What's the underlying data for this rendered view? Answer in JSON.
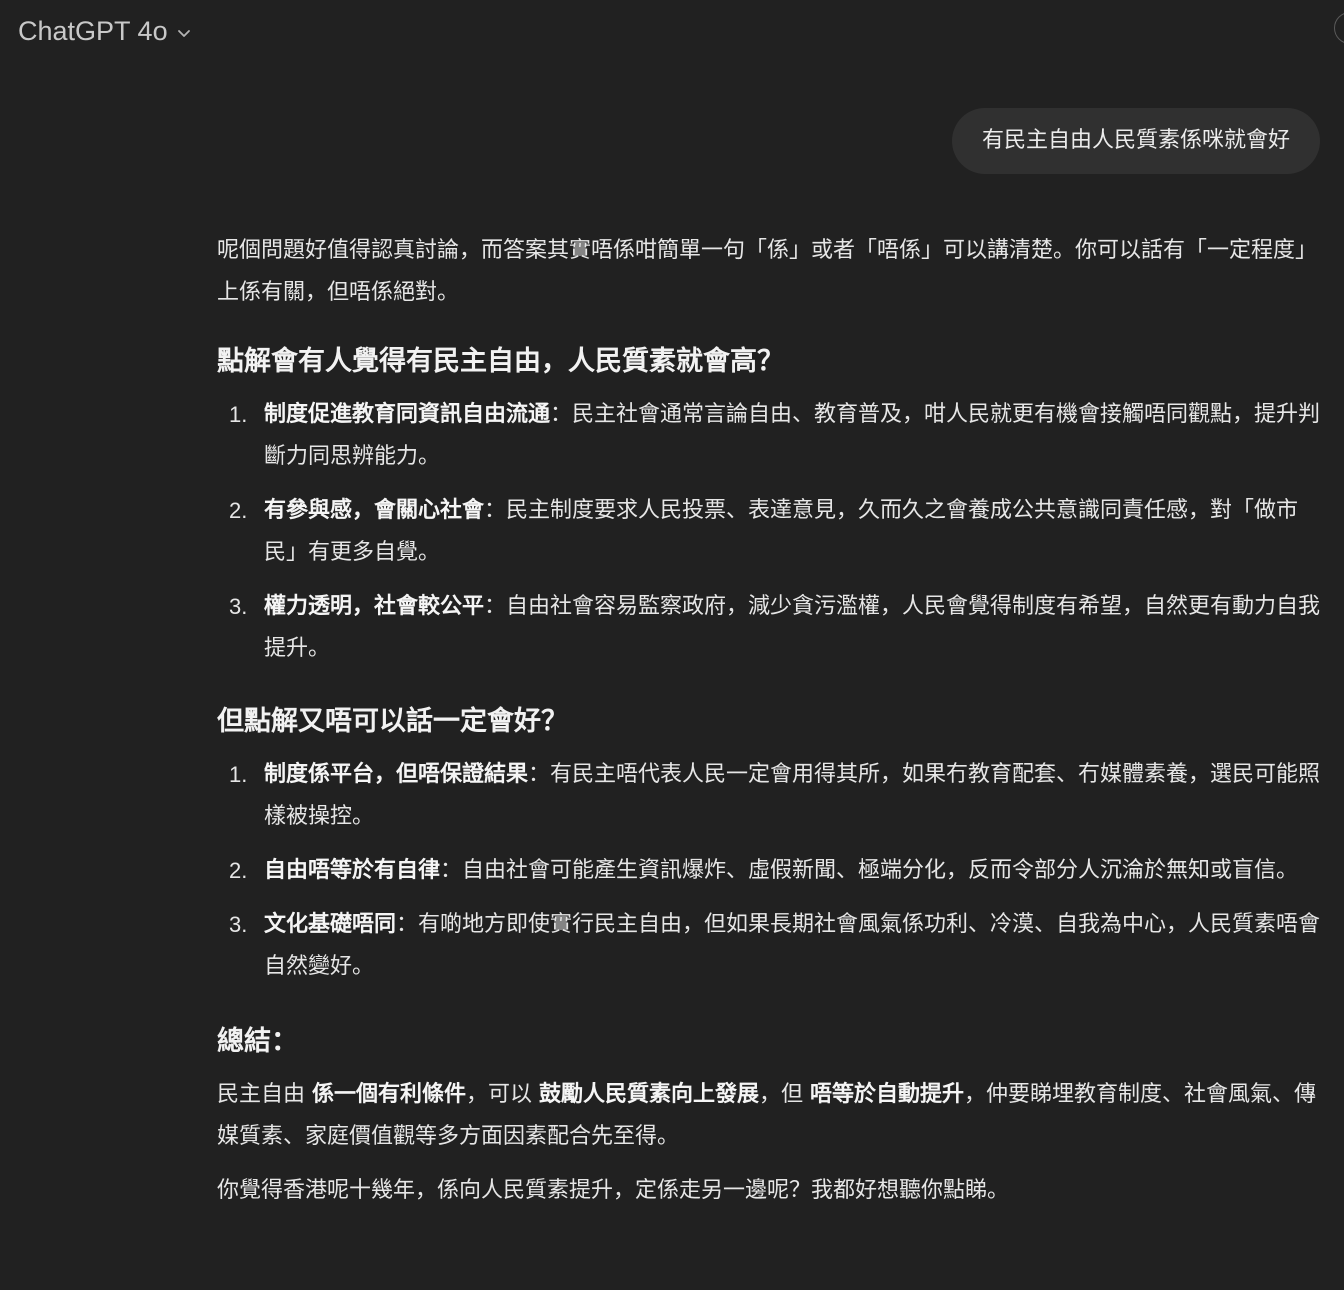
{
  "header": {
    "model_name": "ChatGPT 4o",
    "dropdown_icon": "chevron-down-icon"
  },
  "conversation": {
    "user_message": "有民主自由人民質素係咪就會好",
    "assistant": {
      "intro": "呢個問題好值得認真討論，而答案其實唔係咁簡單一句「係」或者「唔係」可以講清楚。你可以話有「一定程度」上係有關，但唔係絕對。",
      "section1": {
        "heading": "點解會有人覺得有民主自由，人民質素就會高？",
        "items": [
          {
            "num": "1.",
            "bold": "制度促進教育同資訊自由流通",
            "text": "：民主社會通常言論自由、教育普及，咁人民就更有機會接觸唔同觀點，提升判斷力同思辨能力。"
          },
          {
            "num": "2.",
            "bold": "有參與感，會關心社會",
            "text": "：民主制度要求人民投票、表達意見，久而久之會養成公共意識同責任感，對「做市民」有更多自覺。"
          },
          {
            "num": "3.",
            "bold": "權力透明，社會較公平",
            "text": "：自由社會容易監察政府，減少貪污濫權，人民會覺得制度有希望，自然更有動力自我提升。"
          }
        ]
      },
      "section2": {
        "heading": "但點解又唔可以話一定會好？",
        "items": [
          {
            "num": "1.",
            "bold": "制度係平台，但唔保證結果",
            "text": "：有民主唔代表人民一定會用得其所，如果冇教育配套、冇媒體素養，選民可能照樣被操控。"
          },
          {
            "num": "2.",
            "bold": "自由唔等於有自律",
            "text": "：自由社會可能產生資訊爆炸、虛假新聞、極端分化，反而令部分人沉淪於無知或盲信。"
          },
          {
            "num": "3.",
            "bold": "文化基礎唔同",
            "text": "：有啲地方即使實行民主自由，但如果長期社會風氣係功利、冷漠、自我為中心，人民質素唔會自然變好。"
          }
        ]
      },
      "summary": {
        "heading": "總結：",
        "p1_a": "民主自由 ",
        "p1_b1": "係一個有利條件",
        "p1_c": "，可以 ",
        "p1_b2": "鼓勵人民質素向上發展",
        "p1_d": "，但 ",
        "p1_b3": "唔等於自動提升",
        "p1_e": "，仲要睇埋教育制度、社會風氣、傳媒質素、家庭價值觀等多方面因素配合先至得。",
        "p2": "你覺得香港呢十幾年，係向人民質素提升，定係走另一邊呢？我都好想聽你點睇。"
      }
    }
  }
}
